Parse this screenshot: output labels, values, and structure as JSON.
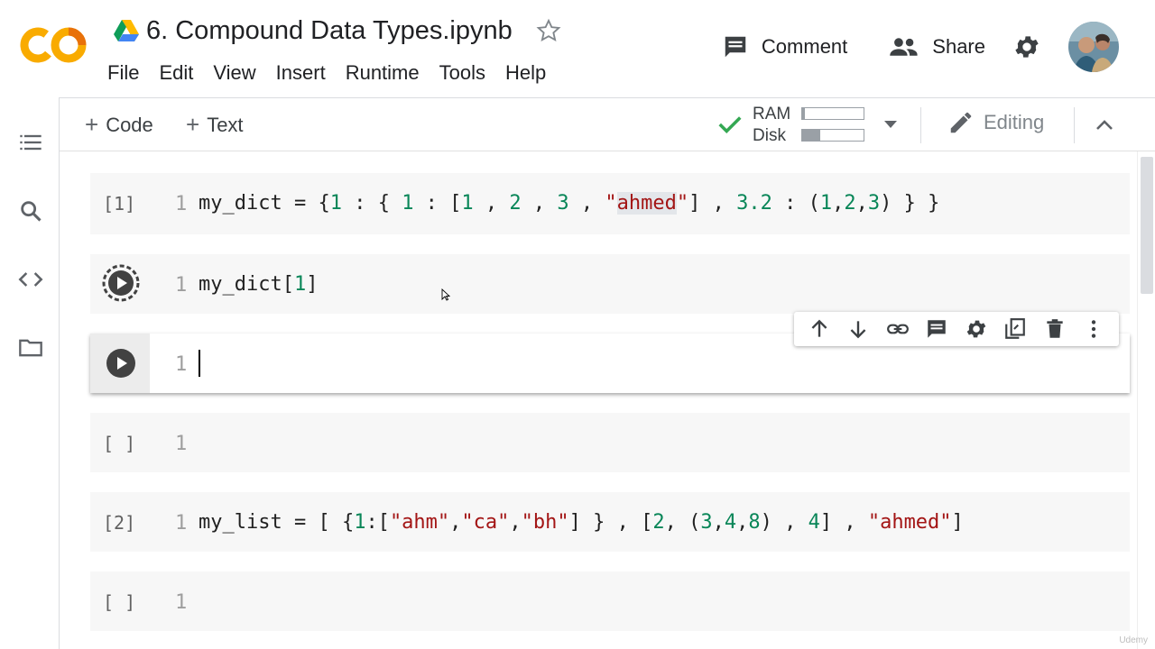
{
  "app": {
    "logo_text": "CO",
    "notebook_title": "6. Compound Data Types.ipynb"
  },
  "menu": [
    "File",
    "Edit",
    "View",
    "Insert",
    "Runtime",
    "Tools",
    "Help"
  ],
  "header_actions": {
    "comment_label": "Comment",
    "share_label": "Share"
  },
  "toolbar": {
    "add_code_label": "Code",
    "add_text_label": "Text",
    "ram_label": "RAM",
    "disk_label": "Disk",
    "ram_usage": 0.04,
    "disk_usage": 0.3,
    "editing_label": "Editing"
  },
  "cells": [
    {
      "exec_count": "[1]",
      "line_no": "1",
      "tokens": [
        {
          "t": "my_dict = {",
          "k": "p"
        },
        {
          "t": "1",
          "k": "n"
        },
        {
          "t": " : { ",
          "k": "p"
        },
        {
          "t": "1",
          "k": "n"
        },
        {
          "t": " : [",
          "k": "p"
        },
        {
          "t": "1",
          "k": "n"
        },
        {
          "t": " , ",
          "k": "p"
        },
        {
          "t": "2",
          "k": "n"
        },
        {
          "t": " , ",
          "k": "p"
        },
        {
          "t": "3",
          "k": "n"
        },
        {
          "t": " , ",
          "k": "p"
        },
        {
          "t": "\"",
          "k": "s"
        },
        {
          "t": "ahmed",
          "k": "sh"
        },
        {
          "t": "\"",
          "k": "s"
        },
        {
          "t": "] , ",
          "k": "p"
        },
        {
          "t": "3.2",
          "k": "n"
        },
        {
          "t": " : (",
          "k": "p"
        },
        {
          "t": "1",
          "k": "n"
        },
        {
          "t": ",",
          "k": "p"
        },
        {
          "t": "2",
          "k": "n"
        },
        {
          "t": ",",
          "k": "p"
        },
        {
          "t": "3",
          "k": "n"
        },
        {
          "t": ") } }",
          "k": "p"
        }
      ]
    },
    {
      "exec_count": "",
      "line_no": "1",
      "tokens": [
        {
          "t": "my_dict[",
          "k": "p"
        },
        {
          "t": "1",
          "k": "n"
        },
        {
          "t": "]",
          "k": "p"
        }
      ]
    },
    {
      "exec_count": "",
      "line_no": "1",
      "tokens": []
    },
    {
      "exec_count": "[ ]",
      "line_no": "1",
      "tokens": []
    },
    {
      "exec_count": "[2]",
      "line_no": "1",
      "tokens": [
        {
          "t": "my_list = [ {",
          "k": "p"
        },
        {
          "t": "1",
          "k": "n"
        },
        {
          "t": ":[",
          "k": "p"
        },
        {
          "t": "\"ahm\"",
          "k": "s"
        },
        {
          "t": ",",
          "k": "p"
        },
        {
          "t": "\"ca\"",
          "k": "s"
        },
        {
          "t": ",",
          "k": "p"
        },
        {
          "t": "\"bh\"",
          "k": "s"
        },
        {
          "t": "] } , [",
          "k": "p"
        },
        {
          "t": "2",
          "k": "n"
        },
        {
          "t": ", (",
          "k": "p"
        },
        {
          "t": "3",
          "k": "n"
        },
        {
          "t": ",",
          "k": "p"
        },
        {
          "t": "4",
          "k": "n"
        },
        {
          "t": ",",
          "k": "p"
        },
        {
          "t": "8",
          "k": "n"
        },
        {
          "t": ") , ",
          "k": "p"
        },
        {
          "t": "4",
          "k": "n"
        },
        {
          "t": "] , ",
          "k": "p"
        },
        {
          "t": "\"ahmed\"",
          "k": "s"
        },
        {
          "t": "]",
          "k": "p"
        }
      ]
    },
    {
      "exec_count": "[ ]",
      "line_no": "1",
      "tokens": []
    }
  ],
  "watermark": "Udemy",
  "colors": {
    "logo_orange": "#F9AB00",
    "logo_dark": "#E8710A",
    "check_green": "#34A853",
    "number_green": "#098658",
    "string_red": "#A31515"
  }
}
